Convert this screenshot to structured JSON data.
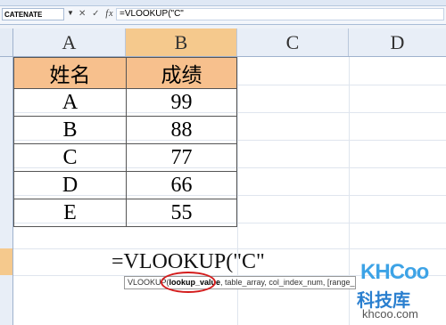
{
  "formula_bar": {
    "name_box": "CATENATE",
    "cancel_icon": "✕",
    "enter_icon": "✓",
    "fx_label": "fx",
    "formula": "=VLOOKUP(\"C\""
  },
  "columns": [
    "A",
    "B",
    "C",
    "D"
  ],
  "selected_column": "B",
  "table": {
    "headers": [
      "姓名",
      "成绩"
    ],
    "rows": [
      [
        "A",
        "99"
      ],
      [
        "B",
        "88"
      ],
      [
        "C",
        "77"
      ],
      [
        "D",
        "66"
      ],
      [
        "E",
        "55"
      ]
    ]
  },
  "cell_edit_text": "=VLOOKUP(\"C\"",
  "tooltip": {
    "func": "VLOOKUP(",
    "current_arg": "lookup_value",
    "rest": ", table_array, col_index_num, [range_lookup])"
  },
  "watermark": {
    "brand": "KHCoo",
    "cn": "科技库",
    "url": "khcoo.com"
  }
}
